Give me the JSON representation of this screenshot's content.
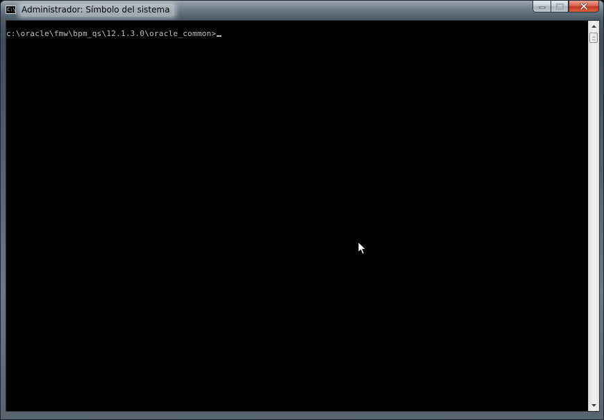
{
  "window": {
    "title": "Administrador: Símbolo del sistema",
    "icon": "console-icon",
    "icon_glyph": "C:\\",
    "controls": {
      "minimize_icon": "minimize-icon",
      "maximize_icon": "maximize-icon",
      "close_icon": "close-icon"
    }
  },
  "console": {
    "prompt": "c:\\oracle\\fmw\\bpm_qs\\12.1.3.0\\oracle_common>",
    "cursor_visible": true,
    "background": "#000000",
    "foreground": "#c0c0c0"
  },
  "scrollbar": {
    "up_icon": "scroll-up-arrow-icon",
    "down_icon": "scroll-down-arrow-icon",
    "position": 0
  },
  "pointer": {
    "icon": "mouse-pointer-icon"
  }
}
